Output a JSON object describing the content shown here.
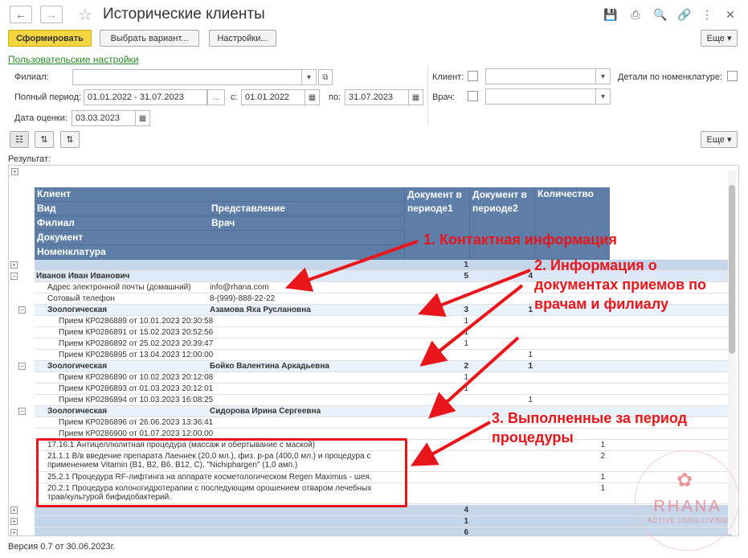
{
  "window": {
    "title": "Исторические клиенты"
  },
  "toolbar": {
    "generate": "Сформировать",
    "choose_variant": "Выбрать вариант...",
    "settings": "Настройки...",
    "more": "Еще"
  },
  "user_settings_link": "Пользовательские настройки",
  "filters": {
    "branch_label": "Филиал:",
    "period_label": "Полный период:",
    "period_value": "01.01.2022 - 31.07.2023",
    "period_more": "...",
    "from_label": "с:",
    "from_value": "01.01.2022",
    "to_label": "по:",
    "to_value": "31.07.2023",
    "eval_label": "Дата оценки:",
    "eval_value": "03.03.2023",
    "client_label": "Клиент:",
    "doctor_label": "Врач:",
    "details_label": "Детали по номенклатуре:"
  },
  "result_label": "Результат:",
  "headers": {
    "client": "Клиент",
    "type": "Вид",
    "representation": "Представление",
    "branch": "Филиал",
    "doctor": "Врач",
    "document": "Документ",
    "nomenclature": "Номенклатура",
    "doc1": "Документ в периоде1",
    "doc2": "Документ в периоде2",
    "qty": "Количество"
  },
  "rows": {
    "r0": {
      "n1": "1"
    },
    "r1": {
      "c1": "Иванов Иван Иванович",
      "n1": "5",
      "n2": "4"
    },
    "r2": {
      "c1": "Адрес электронной почты (домашний)",
      "c2": "info@rhana.com"
    },
    "r3": {
      "c1": "Сотовый телефон",
      "c2": "8-(999)-888-22-22"
    },
    "r4": {
      "c1": "Зоологическая",
      "c2": "Азамова Яха Руслановна",
      "n1": "3",
      "n2": "1"
    },
    "r5": {
      "c1": "Прием КР0286889 от 10.01.2023 20:30:58",
      "n1": "1"
    },
    "r6": {
      "c1": "Прием КР0286891 от 15.02.2023 20:52:56",
      "n1": "1"
    },
    "r7": {
      "c1": "Прием КР0286892 от 25.02.2023 20:39:47",
      "n1": "1"
    },
    "r8": {
      "c1": "Прием КР0286895 от 13.04.2023 12:00:00",
      "n2": "1"
    },
    "r9": {
      "c1": "Зоологическая",
      "c2": "Бойко Валентина Аркадьевна",
      "n1": "2",
      "n2": "1"
    },
    "r10": {
      "c1": "Прием КР0286890 от 10.02.2023 20:12:08",
      "n1": "1"
    },
    "r11": {
      "c1": "Прием КР0286893 от 01.03.2023 20:12:01",
      "n1": "1"
    },
    "r12": {
      "c1": "Прием КР0286894 от 10.03.2023 16:08:25",
      "n2": "1"
    },
    "r13": {
      "c1": "Зоологическая",
      "c2": "Сидорова Ирина Сергеевна"
    },
    "r14": {
      "c1": "Прием КР0286896 от 26.06.2023 13:36:41"
    },
    "r15": {
      "c1": "Прием КР0286900 от 01.07.2023 12:00:00"
    },
    "r16": {
      "c1": "17.16.1 Антицеллюлитная процедура (массаж и обертывание с маской)",
      "n3": "1"
    },
    "r17": {
      "c1": "21.1.1 В/в введение препарата Лаеннек (20,0 мл.), физ. р-ра (400,0 мл.) и процедура с",
      "c1b": "применением Vitamin (B1, B2, B6, B12, C), \"Nichiphargen\" (1,0 амп.)",
      "n3": "2"
    },
    "r18": {
      "c1": "25.2.1 Процедура RF-лифтинга на  аппарате  косметологическом  Regen Maximus - шея.",
      "n3": "1"
    },
    "r19": {
      "c1": "20.2.1 Процедура колоногидротерапии с последующим орошением отваром лечебных",
      "c1b": "трав/культурой бифидобактерий.",
      "n3": "1"
    },
    "r20": {
      "n1": "4"
    },
    "r21": {
      "n1": "1"
    },
    "r22": {
      "n1": "6"
    }
  },
  "annotations": {
    "a1": "1. Контактная информация",
    "a2": "2. Информация о документах приемов по врачам и филиалу",
    "a3": "3. Выполненные за период процедуры"
  },
  "watermark": {
    "brand": "RHANA",
    "tagline": "ACTIVE LONG LIVING"
  },
  "footer": {
    "version": "Версия 0.7 от 30.06.2023г."
  },
  "colors": {
    "accent": "#f5d640",
    "header": "#5e7ea8",
    "annotation": "#e8151a",
    "group": "#dde9f6"
  }
}
